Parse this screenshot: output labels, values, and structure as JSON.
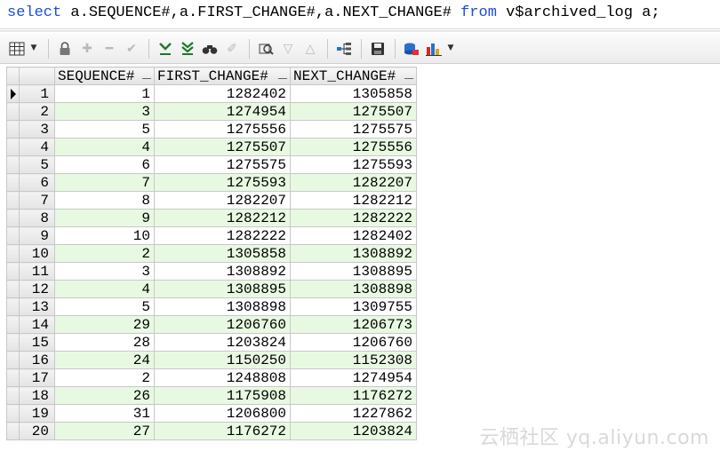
{
  "sql": {
    "kw_select": "select",
    "part1": " a.SEQUENCE#,a.FIRST_CHANGE#,a.NEXT_CHANGE# ",
    "kw_from": "from",
    "part2": " v$archived_log a;"
  },
  "toolbar": {
    "icons": [
      "grid-icon",
      "dropdown-arrow-icon",
      "lock-icon",
      "plus-icon",
      "minus-icon",
      "check-icon",
      "fetch-next-icon",
      "fetch-all-icon",
      "find-icon",
      "clear-icon",
      "query-by-example-icon",
      "filter-down-icon",
      "filter-up-icon",
      "tree-icon",
      "save-icon",
      "export-icon",
      "chart-icon",
      "dropdown-arrow-icon"
    ]
  },
  "grid": {
    "columns": [
      "SEQUENCE#",
      "FIRST_CHANGE#",
      "NEXT_CHANGE#"
    ],
    "rows": [
      {
        "n": "1",
        "seq": "1",
        "first": "1282402",
        "next": "1305858"
      },
      {
        "n": "2",
        "seq": "3",
        "first": "1274954",
        "next": "1275507"
      },
      {
        "n": "3",
        "seq": "5",
        "first": "1275556",
        "next": "1275575"
      },
      {
        "n": "4",
        "seq": "4",
        "first": "1275507",
        "next": "1275556"
      },
      {
        "n": "5",
        "seq": "6",
        "first": "1275575",
        "next": "1275593"
      },
      {
        "n": "6",
        "seq": "7",
        "first": "1275593",
        "next": "1282207"
      },
      {
        "n": "7",
        "seq": "8",
        "first": "1282207",
        "next": "1282212"
      },
      {
        "n": "8",
        "seq": "9",
        "first": "1282212",
        "next": "1282222"
      },
      {
        "n": "9",
        "seq": "10",
        "first": "1282222",
        "next": "1282402"
      },
      {
        "n": "10",
        "seq": "2",
        "first": "1305858",
        "next": "1308892"
      },
      {
        "n": "11",
        "seq": "3",
        "first": "1308892",
        "next": "1308895"
      },
      {
        "n": "12",
        "seq": "4",
        "first": "1308895",
        "next": "1308898"
      },
      {
        "n": "13",
        "seq": "5",
        "first": "1308898",
        "next": "1309755"
      },
      {
        "n": "14",
        "seq": "29",
        "first": "1206760",
        "next": "1206773"
      },
      {
        "n": "15",
        "seq": "28",
        "first": "1203824",
        "next": "1206760"
      },
      {
        "n": "16",
        "seq": "24",
        "first": "1150250",
        "next": "1152308"
      },
      {
        "n": "17",
        "seq": "2",
        "first": "1248808",
        "next": "1274954"
      },
      {
        "n": "18",
        "seq": "26",
        "first": "1175908",
        "next": "1176272"
      },
      {
        "n": "19",
        "seq": "31",
        "first": "1206800",
        "next": "1227862"
      },
      {
        "n": "20",
        "seq": "27",
        "first": "1176272",
        "next": "1203824"
      }
    ]
  },
  "watermark": "云栖社区 yq.aliyun.com"
}
